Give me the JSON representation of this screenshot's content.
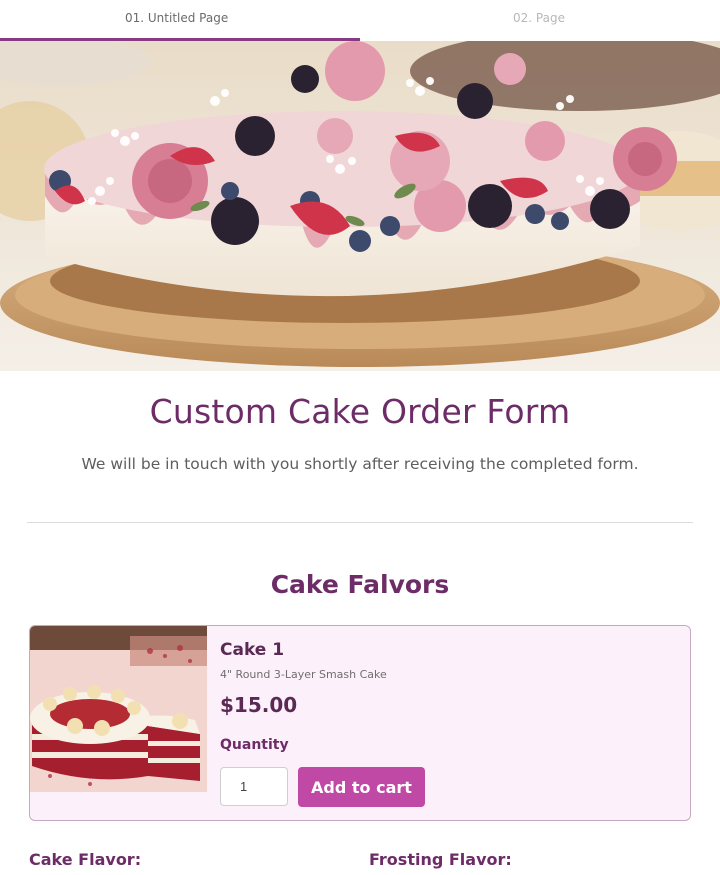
{
  "tabs": [
    {
      "label": "01. Untitled Page",
      "active": true
    },
    {
      "label": "02. Page",
      "active": false
    }
  ],
  "hero": {
    "image": "cake-with-berries-photo"
  },
  "form": {
    "title": "Custom Cake Order Form",
    "subtitle": "We will be in touch with you shortly after receiving the completed form."
  },
  "section": {
    "title": "Cake Falvors"
  },
  "product": {
    "name": "Cake 1",
    "description": "4\" Round 3-Layer Smash Cake",
    "price": "$15.00",
    "quantity_label": "Quantity",
    "quantity_value": "1",
    "add_button": "Add to cart",
    "image": "red-velvet-cake-photo"
  },
  "fields": {
    "cake_flavor_label": "Cake Flavor:",
    "frosting_flavor_label": "Frosting Flavor:"
  },
  "colors": {
    "accent": "#c049a6",
    "heading": "#6d2c67",
    "card_bg": "#fcf1fa"
  }
}
